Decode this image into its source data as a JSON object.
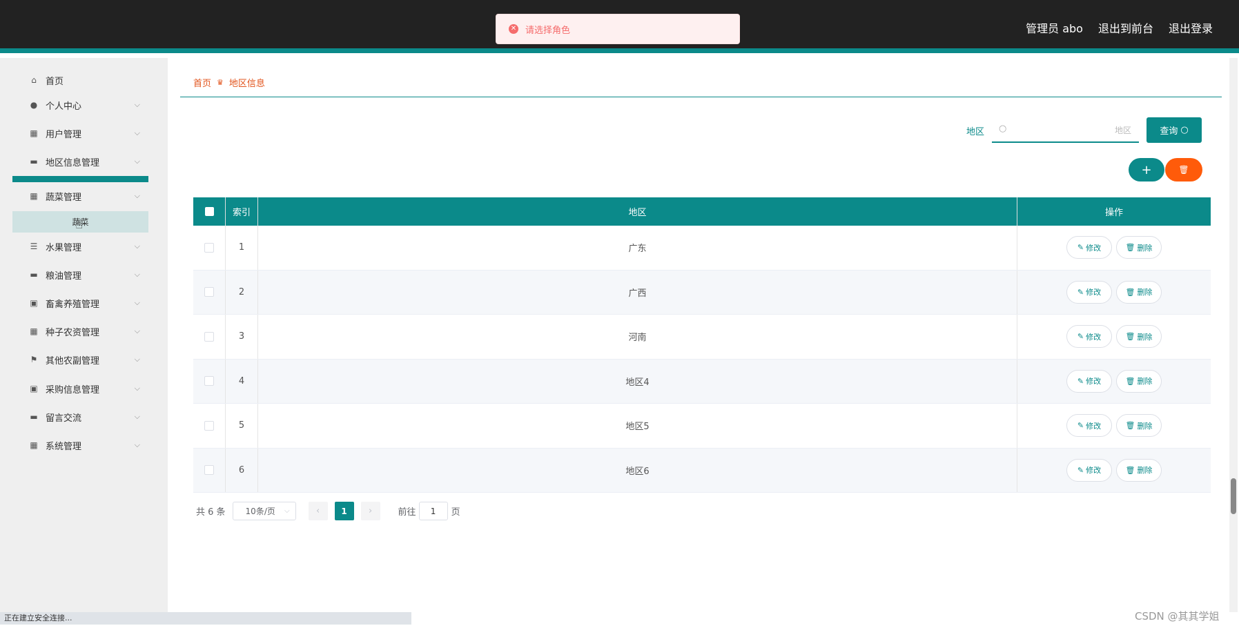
{
  "header": {
    "toast": "请选择角色",
    "user_label": "管理员 abo",
    "back_to_front": "退出到前台",
    "logout": "退出登录"
  },
  "sidebar": {
    "items": [
      {
        "label": "首页",
        "icon": "home-icon"
      },
      {
        "label": "个人中心",
        "icon": "user-icon"
      },
      {
        "label": "用户管理",
        "icon": "grid-icon"
      },
      {
        "label": "地区信息管理",
        "icon": "briefcase-icon"
      },
      {
        "label": "蔬菜管理",
        "icon": "grid-icon"
      },
      {
        "label": "水果管理",
        "icon": "sliders-icon"
      },
      {
        "label": "粮油管理",
        "icon": "box-icon"
      },
      {
        "label": "畜禽养殖管理",
        "icon": "clipboard-icon"
      },
      {
        "label": "种子农资管理",
        "icon": "grid-icon"
      },
      {
        "label": "其他农副管理",
        "icon": "flag-icon"
      },
      {
        "label": "采购信息管理",
        "icon": "clipboard-icon"
      },
      {
        "label": "留言交流",
        "icon": "ticket-icon"
      },
      {
        "label": "系统管理",
        "icon": "grid-icon"
      }
    ],
    "submenu_label": "蔬菜"
  },
  "breadcrumb": {
    "home": "首页",
    "current": "地区信息"
  },
  "search": {
    "label": "地区",
    "placeholder": "地区",
    "button": "查询"
  },
  "table": {
    "headers": [
      "索引",
      "地区",
      "操作"
    ],
    "rows": [
      {
        "index": "1",
        "region": "广东"
      },
      {
        "index": "2",
        "region": "广西"
      },
      {
        "index": "3",
        "region": "河南"
      },
      {
        "index": "4",
        "region": "地区4"
      },
      {
        "index": "5",
        "region": "地区5"
      },
      {
        "index": "6",
        "region": "地区6"
      }
    ],
    "edit_label": "修改",
    "delete_label": "删除"
  },
  "pagination": {
    "total": "共 6 条",
    "page_size": "10条/页",
    "current_page": "1",
    "goto_label": "前往",
    "goto_value": "1",
    "page_unit": "页"
  },
  "status_bar": "正在建立安全连接...",
  "watermark": "CSDN @其其学姐",
  "colors": {
    "primary": "#0b8a8a",
    "danger": "#ff5b0a",
    "header_bg": "#222222",
    "breadcrumb": "#e2541c"
  }
}
